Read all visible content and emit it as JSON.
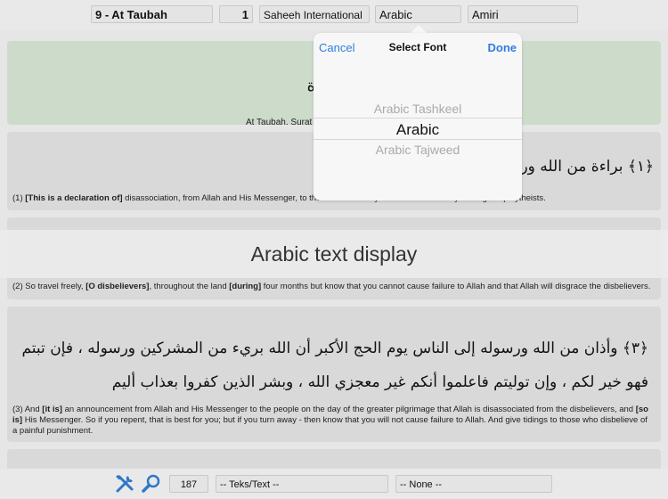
{
  "topbar": {
    "surah": "9 - At Taubah",
    "ayah": "1",
    "translation": "Saheeh International",
    "script": "Arabic",
    "font": "Amiri"
  },
  "header": {
    "arabic_partial": "ة",
    "subtitle_partial": "At Taubah. Surat"
  },
  "verses": [
    {
      "arabic": "﴿١﴾ براءة من الله ورسوله",
      "trans_parts": [
        {
          "t": "(1) ",
          "b": false
        },
        {
          "t": "[This is a declaration of]",
          "b": true
        },
        {
          "t": " disassociation, from Allah and His Messenger, to tho",
          "b": false
        },
        {
          "t": "se with whom you had made a treaty among the",
          "b": false
        },
        {
          "t": " polytheists.",
          "b": false
        }
      ]
    },
    {
      "trans_parts": [
        {
          "t": "(2) So travel freely, ",
          "b": false
        },
        {
          "t": "[O disbelievers]",
          "b": true
        },
        {
          "t": ", throughout the land ",
          "b": false
        },
        {
          "t": "[during]",
          "b": true
        },
        {
          "t": " four months but know that you cannot cause failure to Allah and that Allah will disgrace the disbelievers.",
          "b": false
        }
      ]
    },
    {
      "arabic": "﴿٣﴾ وأذان من الله ورسوله إلى الناس يوم الحج الأكبر أن الله بريء من المشركين ورسوله ، فإن تبتم فهو خير لكم ، وإن توليتم فاعلموا أنكم غير معجزي الله ، وبشر الذين كفروا بعذاب أليم",
      "trans_parts": [
        {
          "t": "(3) And ",
          "b": false
        },
        {
          "t": "[it is]",
          "b": true
        },
        {
          "t": " an announcement from Allah and His Messenger to the people on the day of the greater pilgrimage that Allah is disassociated from the disbelievers, and ",
          "b": false
        },
        {
          "t": "[so is]",
          "b": true
        },
        {
          "t": " His Messenger. So if you repent, that is best for you; but if you turn away - then know that you will not cause failure to Allah. And give tidings to those who disbelieve of a painful punishment.",
          "b": false
        }
      ]
    }
  ],
  "banner": "Arabic text display",
  "popover": {
    "cancel": "Cancel",
    "title": "Select Font",
    "done": "Done",
    "options": [
      "Arabic Tashkeel",
      "Arabic",
      "Arabic Tajweed"
    ]
  },
  "bottombar": {
    "icons": [
      "tools-icon",
      "search-icon"
    ],
    "page": "187",
    "text_filter": "-- Teks/Text --",
    "none_filter": "-- None --"
  }
}
